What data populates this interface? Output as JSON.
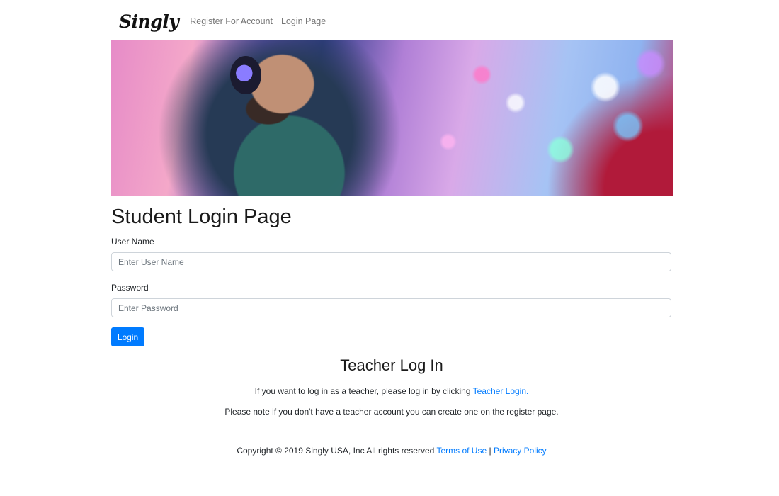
{
  "nav": {
    "brand": "Singly",
    "items": [
      {
        "label": "Register For Account"
      },
      {
        "label": "Login Page"
      }
    ]
  },
  "login": {
    "heading": "Student Login Page",
    "username_label": "User Name",
    "username_placeholder": "Enter User Name",
    "password_label": "Password",
    "password_placeholder": "Enter Password",
    "button_label": "Login"
  },
  "teacher": {
    "heading": "Teacher Log In",
    "line1_text": "If you want to log in as a teacher, please log in by clicking",
    "line1_link": "Teacher Login.",
    "line2_text": "Please note if you don't have a teacher account you can create one on the register page."
  },
  "footer": {
    "copyright": "Copyright © 2019 Singly USA, Inc All rights reserved",
    "terms_link": "Terms of Use",
    "separator": "|",
    "privacy_link": "Privacy Policy"
  },
  "colors": {
    "accent": "#007bff"
  }
}
